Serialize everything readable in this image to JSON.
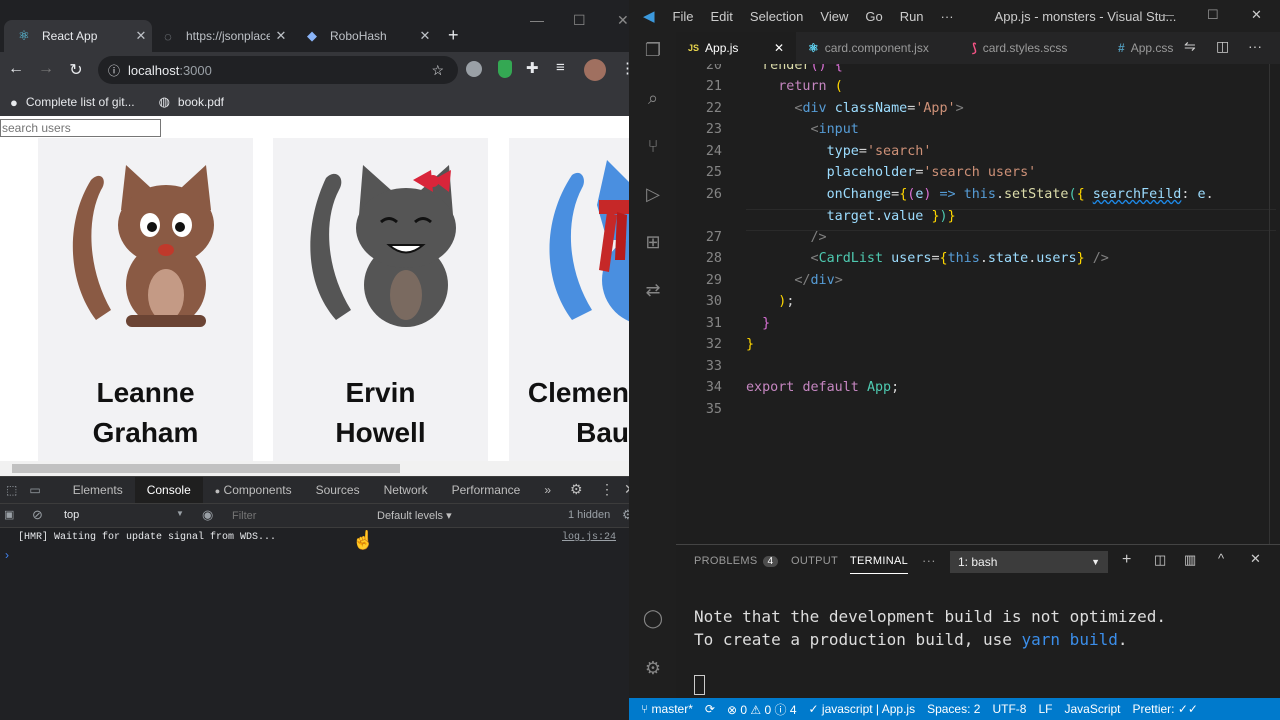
{
  "chrome": {
    "tabs": [
      {
        "label": "React App",
        "icon": "react-icon",
        "active": true
      },
      {
        "label": "https://jsonplace",
        "icon": "page-icon",
        "active": false
      },
      {
        "label": "RoboHash",
        "icon": "robohash-icon",
        "active": false
      }
    ],
    "new_tab": "+",
    "address": {
      "host": "localhost",
      "port": ":3000"
    },
    "bookmarks": [
      {
        "label": "Complete list of git...",
        "icon": "github-icon"
      },
      {
        "label": "book.pdf",
        "icon": "globe-icon"
      }
    ]
  },
  "page": {
    "search_placeholder": "search users",
    "cards": [
      {
        "first": "Leanne",
        "last": "Graham",
        "color": "#8a5a44"
      },
      {
        "first": "Ervin",
        "last": "Howell",
        "color": "#555555"
      },
      {
        "first": "Clemen",
        "last": "Bau",
        "color": "#4a8fe0"
      }
    ]
  },
  "devtools": {
    "tabs": [
      "Elements",
      "Console",
      "Components",
      "Sources",
      "Network",
      "Performance"
    ],
    "active_tab": "Console",
    "more": "»",
    "context": "top",
    "filter_placeholder": "Filter",
    "levels": "Default levels",
    "hidden": "1 hidden",
    "log": "[HMR] Waiting for update signal from WDS...",
    "log_source": "log.js:24",
    "prompt": "›"
  },
  "vscode": {
    "menu": [
      "File",
      "Edit",
      "Selection",
      "View",
      "Go",
      "Run",
      "···"
    ],
    "window_title": "App.js - monsters - Visual Stu...",
    "tabs": [
      {
        "label": "App.js",
        "lang": "JS",
        "active": true
      },
      {
        "label": "card.component.jsx",
        "lang": "⚛",
        "active": false
      },
      {
        "label": "card.styles.scss",
        "lang": "⟆",
        "active": false
      },
      {
        "label": "App.css",
        "lang": "#",
        "active": false
      }
    ],
    "line_numbers": [
      "20",
      "21",
      "22",
      "23",
      "24",
      "25",
      "26",
      "",
      "27",
      "28",
      "29",
      "30",
      "31",
      "32",
      "33",
      "34",
      "35"
    ],
    "panel_tabs": [
      "PROBLEMS",
      "OUTPUT",
      "TERMINAL",
      "···"
    ],
    "problems_count": "4",
    "terminal_select": "1: bash",
    "terminal_lines": [
      "Note that the development build is not optimized.",
      "To create a production build, use ",
      "yarn build",
      "."
    ],
    "status": {
      "branch": "master*",
      "errors": "0",
      "warnings": "0",
      "info": "4",
      "lang_check": "javascript | App.js",
      "spaces": "Spaces: 2",
      "encoding": "UTF-8",
      "eol": "LF",
      "language": "JavaScript",
      "prettier": "Prettier:"
    }
  }
}
